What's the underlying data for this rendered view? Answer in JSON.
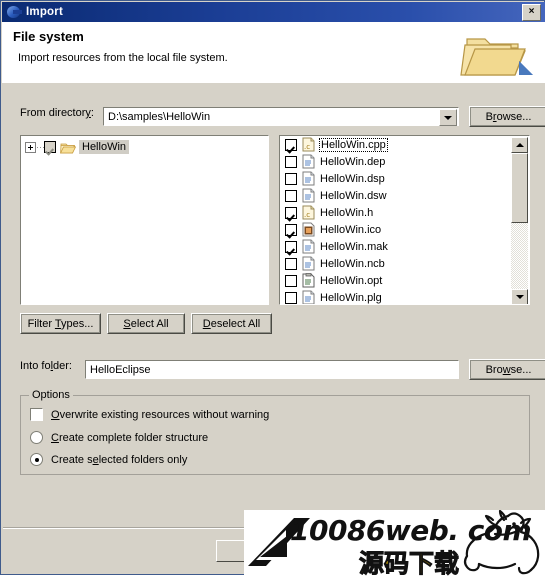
{
  "window": {
    "title": "Import",
    "title_icon": "eclipse-ball-icon",
    "close_label": "×",
    "close_icon": "close-icon"
  },
  "header": {
    "title": "File system",
    "description": "Import resources from the local file system.",
    "banner_icon": "open-folder-icon"
  },
  "from_directory": {
    "label_pre": "From director",
    "label_accel": "y",
    "label_post": ":",
    "value": "D:\\samples\\HelloWin",
    "dropdown_icon": "chevron-down-icon",
    "browse_pre": "B",
    "browse_accel": "r",
    "browse_post": "owse..."
  },
  "tree": {
    "root": {
      "label": "HelloWin",
      "expander": "+",
      "checked": true,
      "grayed": true,
      "icon": "folder-icon",
      "selected": true
    }
  },
  "file_list": {
    "items": [
      {
        "name": "HelloWin.cpp",
        "checked": true,
        "icon": "c-source-file-icon",
        "focused": true
      },
      {
        "name": "HelloWin.dep",
        "checked": false,
        "icon": "generic-file-icon",
        "focused": false
      },
      {
        "name": "HelloWin.dsp",
        "checked": false,
        "icon": "generic-file-icon",
        "focused": false
      },
      {
        "name": "HelloWin.dsw",
        "checked": false,
        "icon": "generic-file-icon",
        "focused": false
      },
      {
        "name": "HelloWin.h",
        "checked": true,
        "icon": "c-source-file-icon",
        "focused": false
      },
      {
        "name": "HelloWin.ico",
        "checked": true,
        "icon": "image-file-icon",
        "focused": false
      },
      {
        "name": "HelloWin.mak",
        "checked": true,
        "icon": "generic-file-icon",
        "focused": false
      },
      {
        "name": "HelloWin.ncb",
        "checked": false,
        "icon": "generic-file-icon",
        "focused": false
      },
      {
        "name": "HelloWin.opt",
        "checked": false,
        "icon": "binary-file-icon",
        "focused": false
      },
      {
        "name": "HelloWin.plg",
        "checked": false,
        "icon": "generic-file-icon",
        "focused": false
      }
    ],
    "scrollbar": {
      "up_icon": "scroll-up-icon",
      "down_icon": "scroll-down-icon"
    }
  },
  "buttons": {
    "filter_pre": "Filter ",
    "filter_accel": "T",
    "filter_post": "ypes...",
    "select_pre": "",
    "select_accel": "S",
    "select_post": "elect All",
    "deselect_pre": "",
    "deselect_accel": "D",
    "deselect_post": "eselect All"
  },
  "into_folder": {
    "label_pre": "Into fo",
    "label_accel": "l",
    "label_post": "der:",
    "value": "HelloEclipse",
    "browse_pre": "Bro",
    "browse_accel": "w",
    "browse_post": "se..."
  },
  "options": {
    "group_title": "Options",
    "overwrite": {
      "pre": "",
      "accel": "O",
      "post": "verwrite existing resources without warning",
      "checked": false
    },
    "create_complete": {
      "pre": "",
      "accel": "C",
      "post": "reate complete folder structure",
      "selected": false
    },
    "create_selected": {
      "pre": "Create s",
      "accel": "e",
      "post": "lected folders only",
      "selected": true
    }
  },
  "watermark": {
    "text": "10086web. com",
    "subtext": "源码下载",
    "logo_icon": "letter-a-logo-icon",
    "mascot_icon": "rhino-icon"
  }
}
